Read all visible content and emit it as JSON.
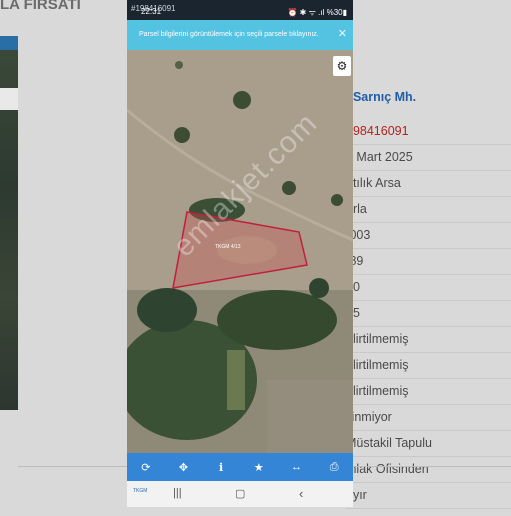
{
  "background": {
    "title": "LA FIRSATI",
    "header_link": "/ Sarnıç Mh.",
    "details": [
      {
        "value": "198416091",
        "red": true
      },
      {
        "value": "3 Mart 2025",
        "red": false
      },
      {
        "value": "atılık Arsa",
        "red": false
      },
      {
        "value": "arla",
        "red": false
      },
      {
        "value": ".003",
        "red": false
      },
      {
        "value": ".89",
        "red": false
      },
      {
        "value": "30",
        "red": false
      },
      {
        "value": "15",
        "red": false
      },
      {
        "value": "elirtilmemiş",
        "red": false
      },
      {
        "value": "elirtilmemiş",
        "red": false
      },
      {
        "value": "elirtilmemiş",
        "red": false
      },
      {
        "value": "ilinmiyor",
        "red": false
      },
      {
        "value": "Müstakil Tapulu",
        "red": false
      },
      {
        "value": "mlak Ofisinden",
        "red": false
      },
      {
        "value": "ayır",
        "red": false
      }
    ]
  },
  "phone": {
    "status_time": "22:31",
    "status_ghost": "#198416091",
    "status_icons": "⏰ ✱ ᯤ .ıl %30▮",
    "banner_text": "Parsel bilgilerini görüntülemek için seçili parsele tıklayınız.",
    "banner_close": "✕",
    "gear_glyph": "⚙",
    "parcel_label": "TKGM 4/13",
    "watermark": "emlakjet.com",
    "toolbar": [
      {
        "name": "refresh-icon",
        "glyph": "⟳"
      },
      {
        "name": "move-icon",
        "glyph": "✥"
      },
      {
        "name": "info-icon",
        "glyph": "ℹ"
      },
      {
        "name": "star-icon",
        "glyph": "★"
      },
      {
        "name": "measure-icon",
        "glyph": "↔"
      },
      {
        "name": "print-icon",
        "glyph": "⎙"
      }
    ],
    "nav": {
      "logo": "TKGM",
      "recent": "|||",
      "home": "▢",
      "back": "‹"
    },
    "colors": {
      "toolbar": "#3585d6",
      "banner": "#54c3e2",
      "parcel": "#c0203a"
    }
  }
}
